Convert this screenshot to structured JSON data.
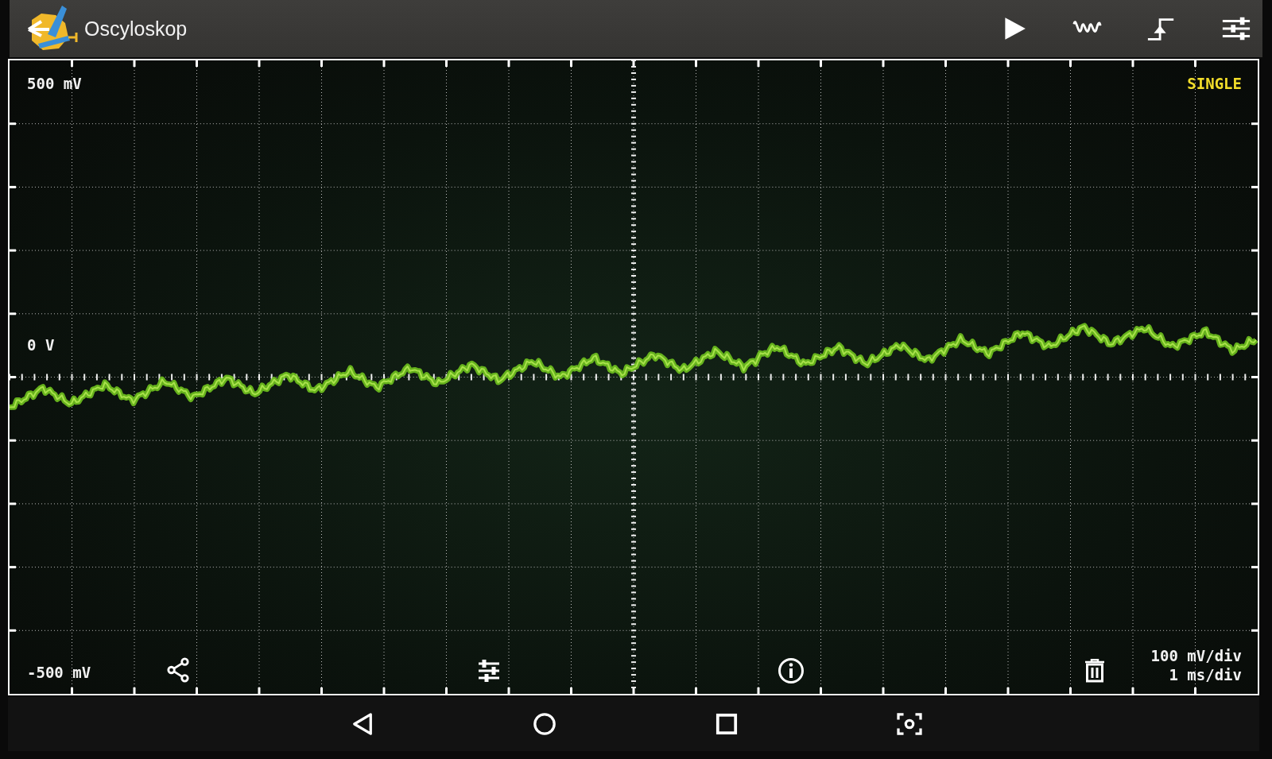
{
  "app_bar": {
    "title": "Oscyloskop"
  },
  "scope": {
    "trigger_mode": "SINGLE",
    "top_label": "500 mV",
    "zero_label": "0 V",
    "bottom_label": "-500 mV",
    "scale": [
      "100 mV/div",
      "1 ms/div"
    ]
  }
}
